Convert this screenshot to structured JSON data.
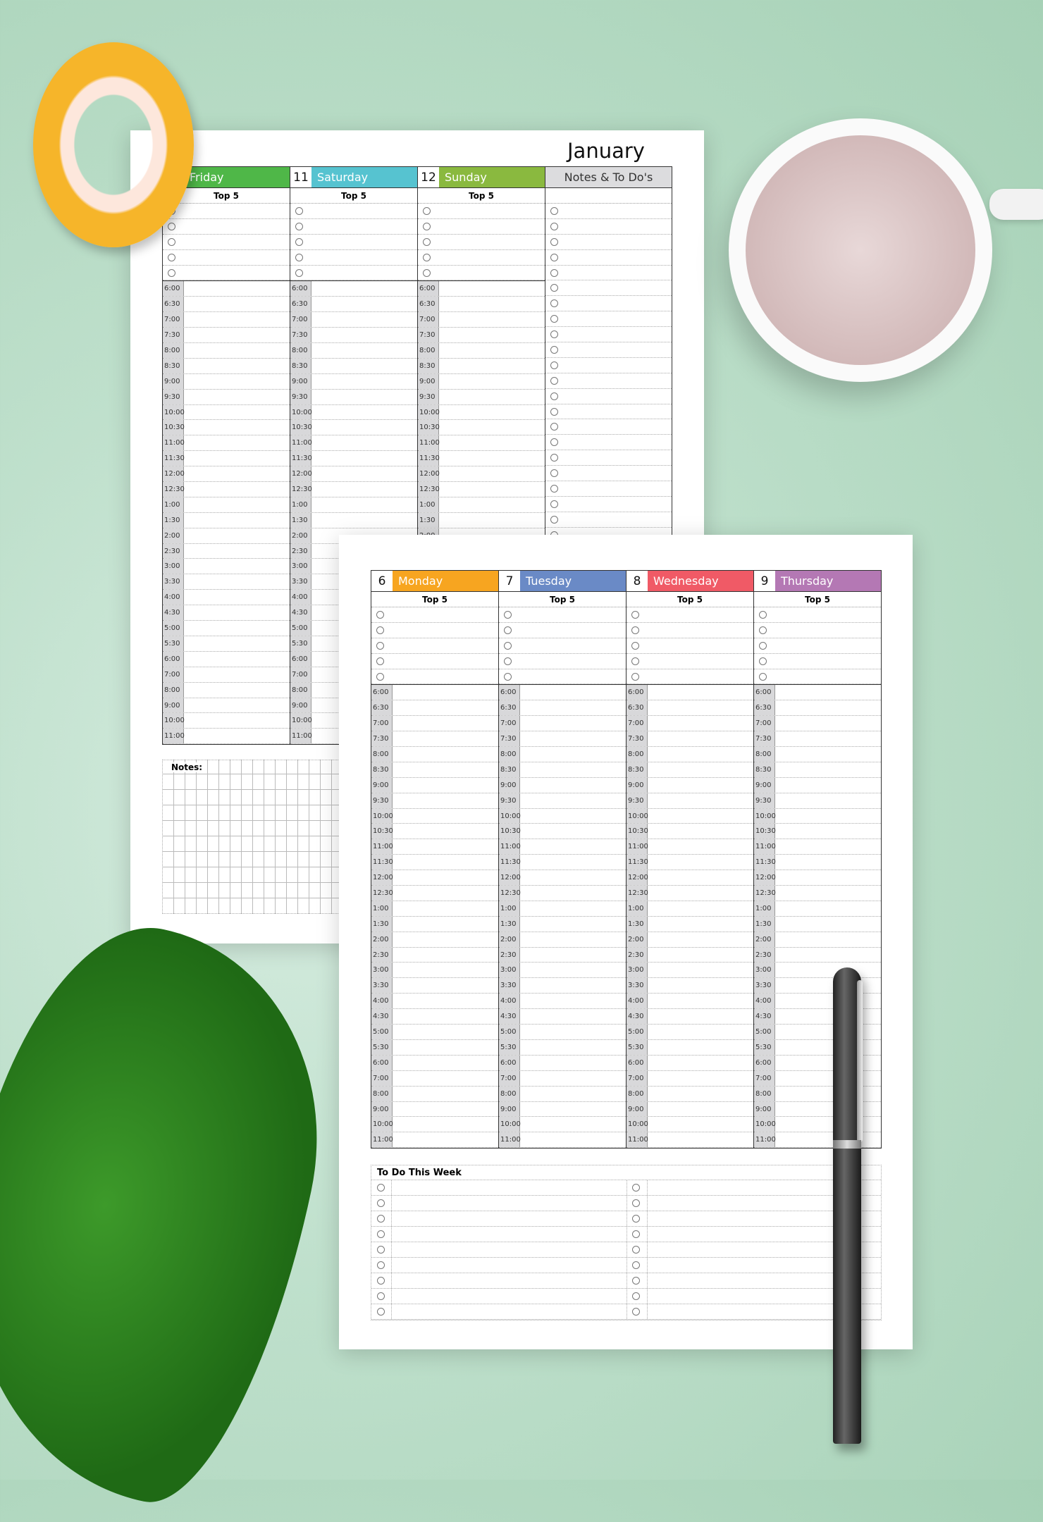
{
  "back_page": {
    "month": "January",
    "days": [
      {
        "number": "",
        "name": "Friday",
        "color": "#4fb748"
      },
      {
        "number": "11",
        "name": "Saturday",
        "color": "#56c3d0"
      },
      {
        "number": "12",
        "name": "Sunday",
        "color": "#8ab93f"
      }
    ],
    "notes_column_title": "Notes & To Do's",
    "notes_label": "Notes:"
  },
  "front_page": {
    "days": [
      {
        "number": "6",
        "name": "Monday",
        "color": "#f7a520"
      },
      {
        "number": "7",
        "name": "Tuesday",
        "color": "#6a8ac6"
      },
      {
        "number": "8",
        "name": "Wednesday",
        "color": "#f05a66"
      },
      {
        "number": "9",
        "name": "Thursday",
        "color": "#b478b4"
      }
    ],
    "todo_title": "To Do This Week"
  },
  "top5_label": "Top 5",
  "times": [
    "6:00",
    "6:30",
    "7:00",
    "7:30",
    "8:00",
    "8:30",
    "9:00",
    "9:30",
    "10:00",
    "10:30",
    "11:00",
    "11:30",
    "12:00",
    "12:30",
    "1:00",
    "1:30",
    "2:00",
    "2:30",
    "3:00",
    "3:30",
    "4:00",
    "4:30",
    "5:00",
    "5:30",
    "6:00",
    "7:00",
    "8:00",
    "9:00",
    "10:00",
    "11:00"
  ]
}
